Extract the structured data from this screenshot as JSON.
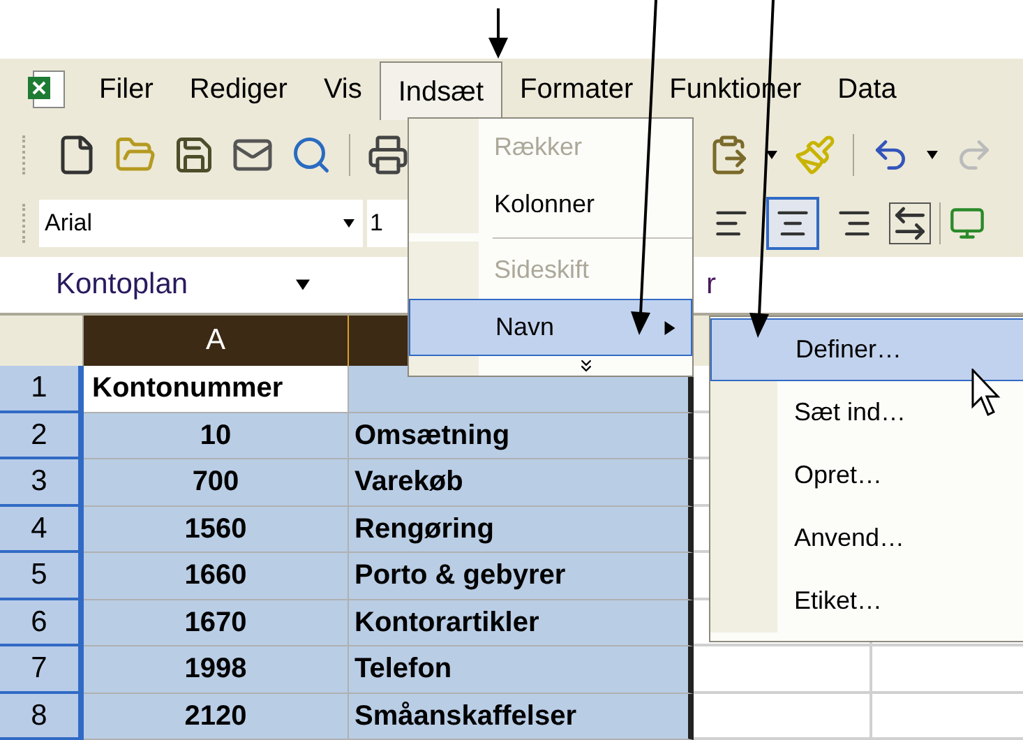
{
  "menu_bar": {
    "items": [
      {
        "label": "Filer",
        "selected": false
      },
      {
        "label": "Rediger",
        "selected": false
      },
      {
        "label": "Vis",
        "selected": false
      },
      {
        "label": "Indsæt",
        "selected": true
      },
      {
        "label": "Formater",
        "selected": false
      },
      {
        "label": "Funktioner",
        "selected": false
      },
      {
        "label": "Data",
        "selected": false
      }
    ]
  },
  "format_toolbar": {
    "font": "Arial",
    "font_size": "1",
    "alignment": [
      {
        "selected": false
      },
      {
        "selected": true
      },
      {
        "selected": false
      }
    ]
  },
  "name_box": "Kontoplan",
  "formula_bar": "r",
  "columns": [
    "A"
  ],
  "rows": [
    {
      "header": "1",
      "account": "Kontonummer",
      "selected": true,
      "active": true
    },
    {
      "header": "2",
      "account": "10",
      "name": "Omsætning",
      "selected": true,
      "active": false
    },
    {
      "header": "3",
      "account": "700",
      "name": "Varekøb",
      "selected": true,
      "active": false
    },
    {
      "header": "4",
      "account": "1560",
      "name": "Rengøring",
      "selected": true,
      "active": false
    },
    {
      "header": "5",
      "account": "1660",
      "name": "Porto & gebyrer",
      "selected": true,
      "active": false
    },
    {
      "header": "6",
      "account": "1670",
      "name": "Kontorartikler",
      "selected": true,
      "active": false
    },
    {
      "header": "7",
      "account": "1998",
      "name": "Telefon",
      "selected": true,
      "active": false
    },
    {
      "header": "8",
      "account": "2120",
      "name": "Småanskaffelser",
      "selected": true,
      "active": false
    }
  ],
  "insert_menu": [
    {
      "kind": "item",
      "label": "Rækker",
      "disabled": true,
      "selected": false
    },
    {
      "kind": "item",
      "label": "Kolonner",
      "disabled": false,
      "selected": false
    },
    {
      "kind": "separator"
    },
    {
      "kind": "item",
      "label": "Sideskift",
      "disabled": true,
      "selected": false
    },
    {
      "kind": "submenu",
      "label": "Navn",
      "disabled": false,
      "selected": true
    },
    {
      "kind": "expand"
    }
  ],
  "name_submenu": [
    {
      "label": "Definer…",
      "selected": true
    },
    {
      "label": "Sæt ind…",
      "selected": false
    },
    {
      "label": "Opret…",
      "selected": false
    },
    {
      "label": "Anvend…",
      "selected": false
    },
    {
      "label": "Etiket…",
      "selected": false
    }
  ]
}
